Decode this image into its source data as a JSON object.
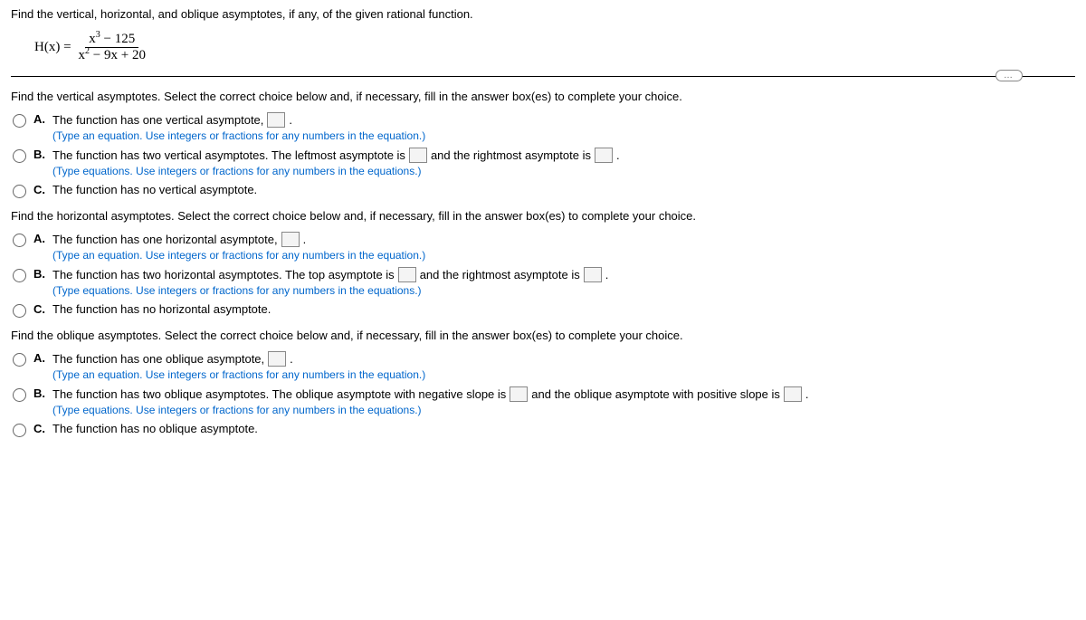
{
  "header": {
    "prompt": "Find the vertical, horizontal, and oblique asymptotes, if any, of the given rational function.",
    "func_name": "H(x) = ",
    "num_a": "x",
    "num_exp": "3",
    "num_b": " − 125",
    "den_a": "x",
    "den_exp": "2",
    "den_b": " − 9x + 20"
  },
  "ellipsis": "…",
  "sections": {
    "vertical": {
      "prompt": "Find the vertical asymptotes. Select the correct choice below and, if necessary, fill in the answer box(es) to complete your choice.",
      "A": {
        "t1": "The function has one vertical asymptote,",
        "t2": ".",
        "hint": "(Type an equation. Use integers or fractions for any numbers in the equation.)"
      },
      "B": {
        "t1": "The function has two vertical asymptotes. The leftmost asymptote is",
        "t2": "and the rightmost asymptote is",
        "t3": ".",
        "hint": "(Type equations. Use integers or fractions for any numbers in the equations.)"
      },
      "C": {
        "t1": "The function has no vertical asymptote."
      }
    },
    "horizontal": {
      "prompt": "Find the horizontal asymptotes. Select the correct choice below and, if necessary, fill in the answer box(es) to complete your choice.",
      "A": {
        "t1": "The function has one horizontal asymptote,",
        "t2": ".",
        "hint": "(Type an equation. Use integers or fractions for any numbers in the equation.)"
      },
      "B": {
        "t1": "The function has two horizontal asymptotes. The top asymptote is",
        "t2": "and the rightmost asymptote is",
        "t3": ".",
        "hint": "(Type equations. Use integers or fractions for any numbers in the equations.)"
      },
      "C": {
        "t1": "The function has no horizontal asymptote."
      }
    },
    "oblique": {
      "prompt": "Find the oblique asymptotes. Select the correct choice below and, if necessary, fill in the answer box(es) to complete your choice.",
      "A": {
        "t1": "The function has one oblique asymptote,",
        "t2": ".",
        "hint": "(Type an equation. Use integers or fractions for any numbers in the equation.)"
      },
      "B": {
        "t1": "The function has two oblique asymptotes. The oblique asymptote with negative slope is",
        "t2": "and the oblique asymptote with positive slope is",
        "t3": ".",
        "hint": "(Type equations. Use integers or fractions for any numbers in the equations.)"
      },
      "C": {
        "t1": "The function has no oblique asymptote."
      }
    }
  },
  "labels": {
    "A": "A.",
    "B": "B.",
    "C": "C."
  }
}
